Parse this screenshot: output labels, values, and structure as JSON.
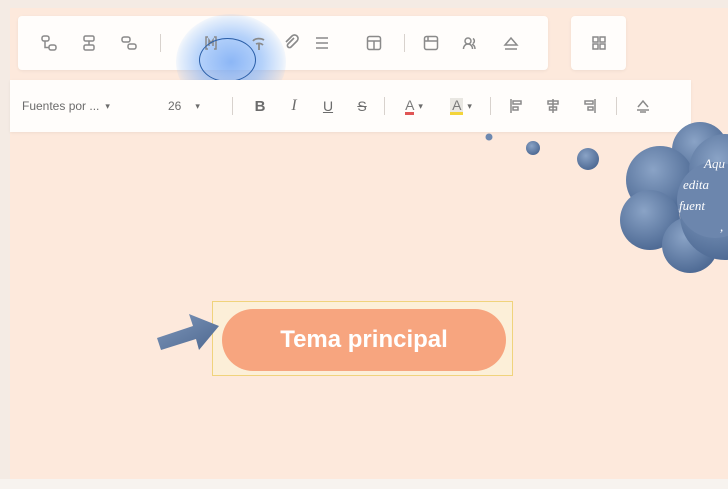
{
  "toolbar_top": {
    "icons": [
      "subtopic-icon",
      "topic-before-icon",
      "floating-topic-icon",
      "relationship-icon",
      "callout-icon",
      "boundary-icon",
      "summary-icon",
      "frame-icon",
      "note-icon",
      "attachment-icon",
      "insert-icon"
    ],
    "right_icon": "layout-icon",
    "highlighted_icon": "relationship-icon",
    "highlight_color": "#2b5fa8"
  },
  "toolbar_format": {
    "font_family": "Fuentes por ...",
    "font_family_arrow": "▾",
    "font_size": "26",
    "font_size_arrow": "▾",
    "bold_label": "B",
    "italic_label": "I",
    "underline_label": "U",
    "strike_label": "S",
    "font_color_label": "A",
    "highlight_label": "A",
    "dropdown_arrow": "▾",
    "font_color_accent": "#e05555",
    "highlight_accent": "#f3d43a"
  },
  "tooltip": {
    "lines": [
      "Aqu",
      "edita",
      "fuent",
      ","
    ],
    "color": "#6b84a8"
  },
  "topic": {
    "label": "Tema principal",
    "fill": "#f7a57f",
    "frame_color": "#f0d37c"
  }
}
